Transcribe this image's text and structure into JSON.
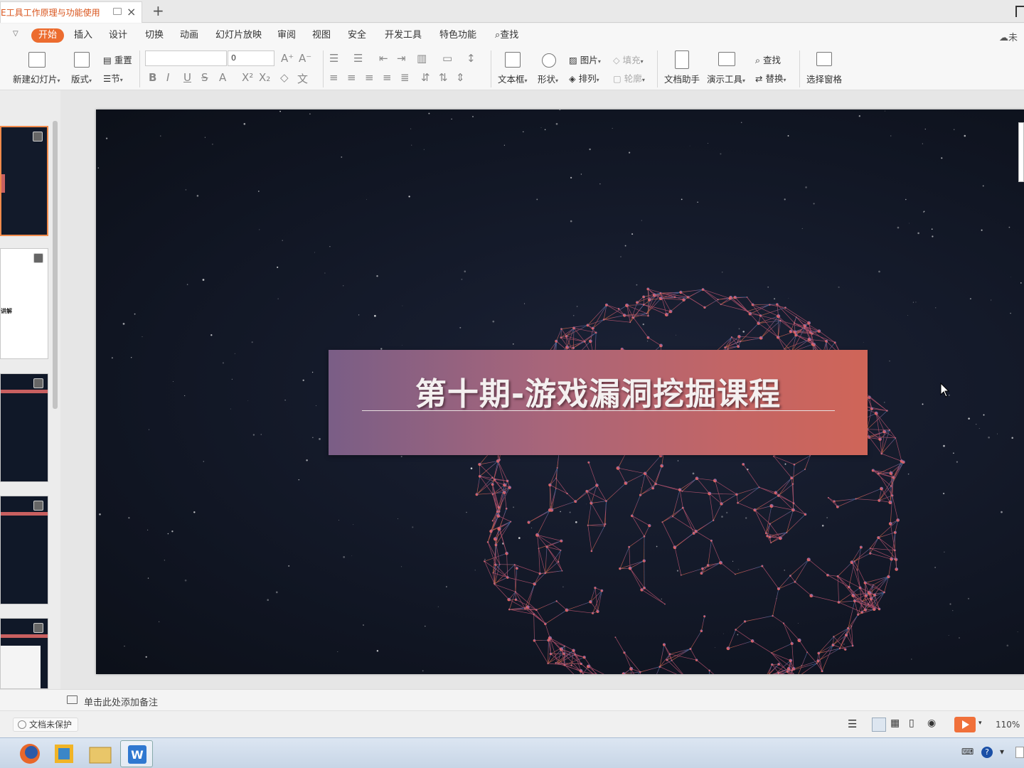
{
  "window": {
    "tab_title": "E工具工作原理与功能使用",
    "new_tab": "+"
  },
  "menu": {
    "items": [
      "开始",
      "插入",
      "设计",
      "切换",
      "动画",
      "幻灯片放映",
      "审阅",
      "视图",
      "安全",
      "开发工具",
      "特色功能"
    ],
    "search": "查找",
    "cloud": "未"
  },
  "ribbon": {
    "new_slide": "新建幻灯片",
    "layout": "版式",
    "reset": "重置",
    "section": "节",
    "font_size": "0",
    "textbox": "文本框",
    "shape": "形状",
    "picture": "图片",
    "arrange": "排列",
    "fill": "填充",
    "outline": "轮廓",
    "doc_helper": "文档助手",
    "present_tools": "演示工具",
    "find": "查找",
    "replace": "替换",
    "selection_pane": "选择窗格"
  },
  "thumbnails": {
    "slide2_text": "讲解"
  },
  "slide": {
    "title": "第十期-游戏漏洞挖掘课程"
  },
  "notes": {
    "placeholder": "单击此处添加备注"
  },
  "status": {
    "protect": "文档未保护",
    "zoom": "110%"
  },
  "colors": {
    "accent": "#ec6c2f",
    "banner_start": "#7a5e86",
    "banner_end": "#cf6558",
    "slide_bg": "#121826"
  }
}
